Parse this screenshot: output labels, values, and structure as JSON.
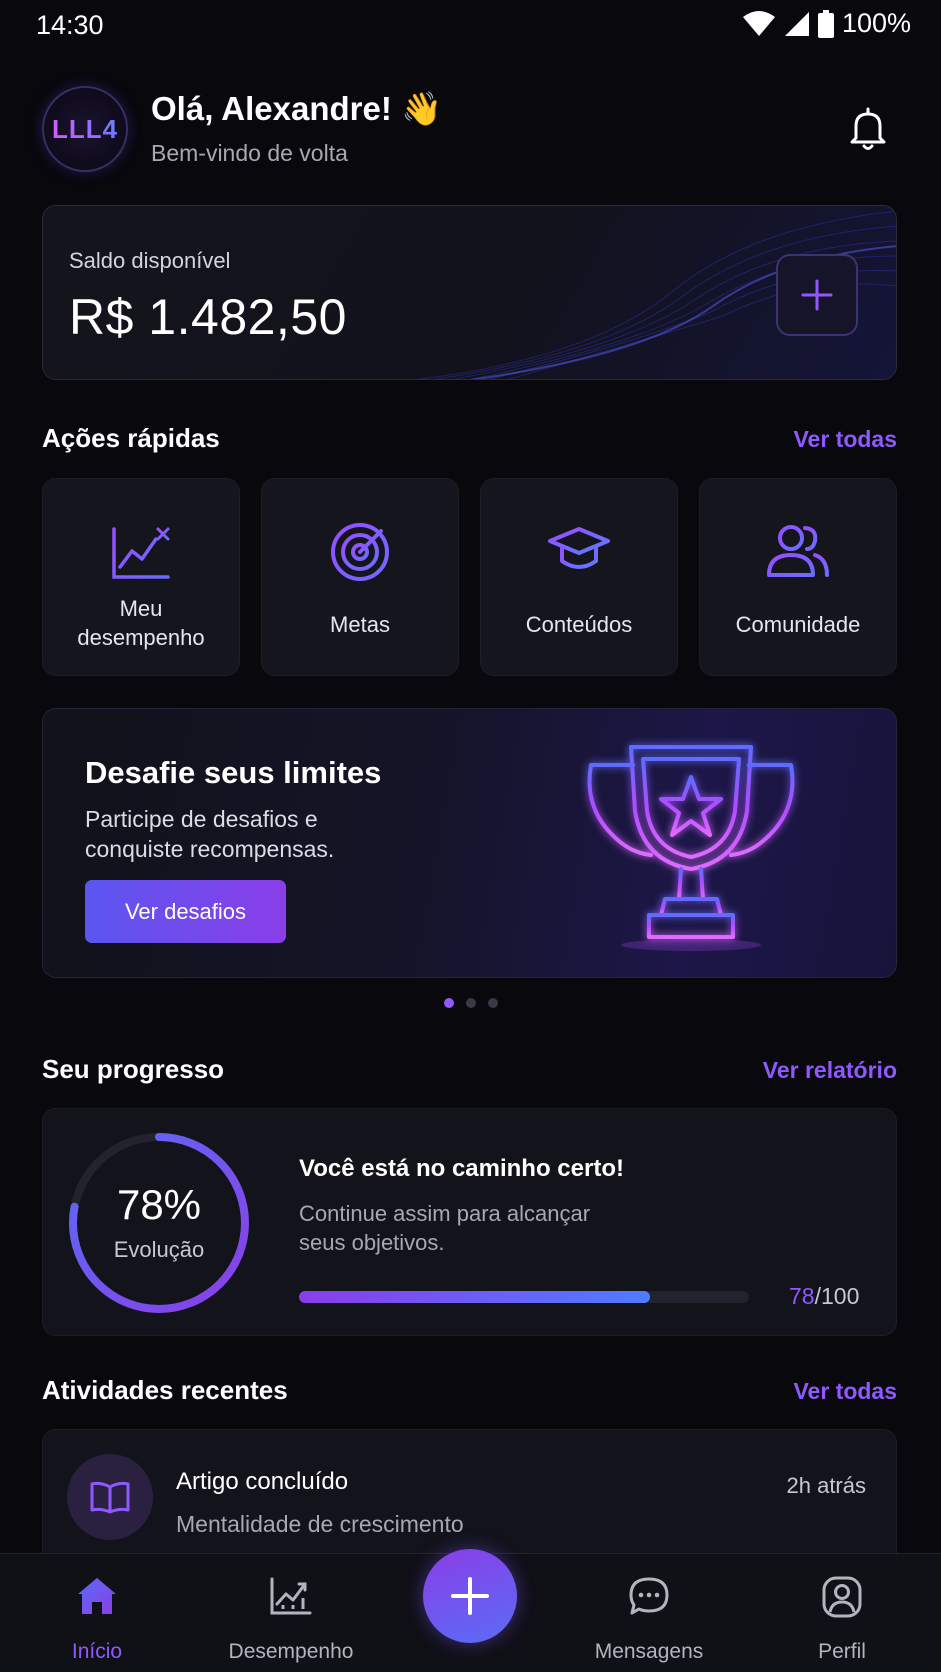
{
  "status_bar": {
    "time": "14:30",
    "battery": "100%"
  },
  "header": {
    "avatar_text": "LLL4",
    "greeting": "Olá, Alexandre! 👋",
    "subtitle": "Bem-vindo de volta"
  },
  "balance": {
    "label": "Saldo disponível",
    "value": "R$ 1.482,50"
  },
  "quick_actions": {
    "title": "Ações rápidas",
    "link": "Ver todas",
    "items": [
      {
        "label_line1": "Meu",
        "label_line2": "desempenho",
        "icon": "performance-chart-icon"
      },
      {
        "label": "Metas",
        "icon": "target-icon"
      },
      {
        "label": "Conteúdos",
        "icon": "graduation-cap-icon"
      },
      {
        "label": "Comunidade",
        "icon": "community-icon"
      }
    ]
  },
  "banner": {
    "title": "Desafie seus limites",
    "text": "Participe de desafios e conquiste recompensas.",
    "button": "Ver desafios",
    "icon": "trophy-icon",
    "pages": 3,
    "active_page": 1
  },
  "progress": {
    "title": "Seu progresso",
    "link": "Ver relatório",
    "percent_label": "78%",
    "percent_value": 78,
    "ring_label": "Evolução",
    "headline": "Você está no caminho certo!",
    "text": "Continue assim para alcançar seus objetivos.",
    "current": "78",
    "total": "/100"
  },
  "activities": {
    "title": "Atividades recentes",
    "link": "Ver todas",
    "items": [
      {
        "title": "Artigo concluído",
        "subtitle": "Mentalidade de crescimento",
        "time": "2h atrás",
        "icon": "book-icon"
      }
    ]
  },
  "bottom_nav": {
    "items": [
      {
        "label": "Início",
        "icon": "home-icon",
        "active": true
      },
      {
        "label": "Desempenho",
        "icon": "chart-icon",
        "active": false
      },
      {
        "label": "Mensagens",
        "icon": "chat-icon",
        "active": false
      },
      {
        "label": "Perfil",
        "icon": "profile-icon",
        "active": false
      }
    ],
    "fab_icon": "plus-icon"
  },
  "colors": {
    "background": "#08080d",
    "accent": "#8f59ff",
    "accent_blue": "#4f7cff",
    "card": "#13131b"
  }
}
